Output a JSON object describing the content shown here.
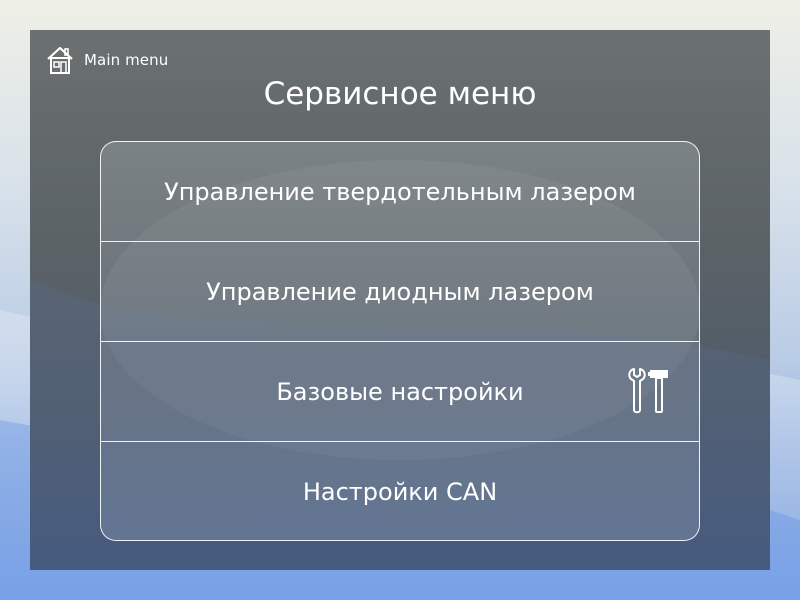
{
  "header": {
    "home_label": "Main menu",
    "home_icon": "home-icon",
    "title": "Сервисное меню"
  },
  "menu": {
    "items": [
      {
        "label": "Управление твердотельным лазером"
      },
      {
        "label": "Управление диодным лазером"
      },
      {
        "label": "Базовые настройки",
        "icon": "tools-icon"
      },
      {
        "label": "Настройки CAN"
      }
    ]
  },
  "colors": {
    "panel": "#5d6467",
    "text": "#ffffff",
    "border": "#ffffff"
  }
}
